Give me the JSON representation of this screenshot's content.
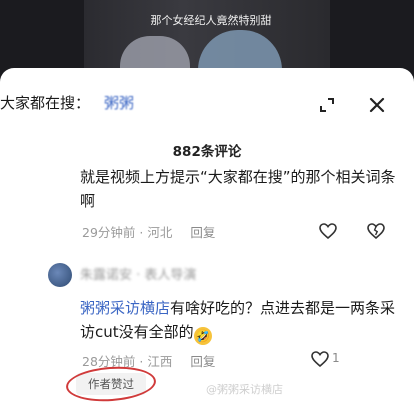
{
  "video": {
    "caption": "那个女经纪人竟然特别甜"
  },
  "search": {
    "label": "大家都在搜：",
    "term": "粥粥"
  },
  "comments_header": {
    "count": "882条评论"
  },
  "comment1": {
    "text": "就是视频上方提示“大家都在搜”的那个相关词条啊",
    "time_location": "29分钟前 · 河北",
    "reply_label": "回复"
  },
  "comment2": {
    "username": "朱露诺安  · 表人导演",
    "mention": "粥粥采访横店",
    "text": "有啥好吃的？点进去都是一两条采访cut没有全部的",
    "emoji": "🤣",
    "time_location": "28分钟前 · 江西",
    "reply_label": "回复",
    "like_count": "1",
    "author_like_badge": "作者赞过"
  },
  "watermark": "@粥粥采访横店"
}
